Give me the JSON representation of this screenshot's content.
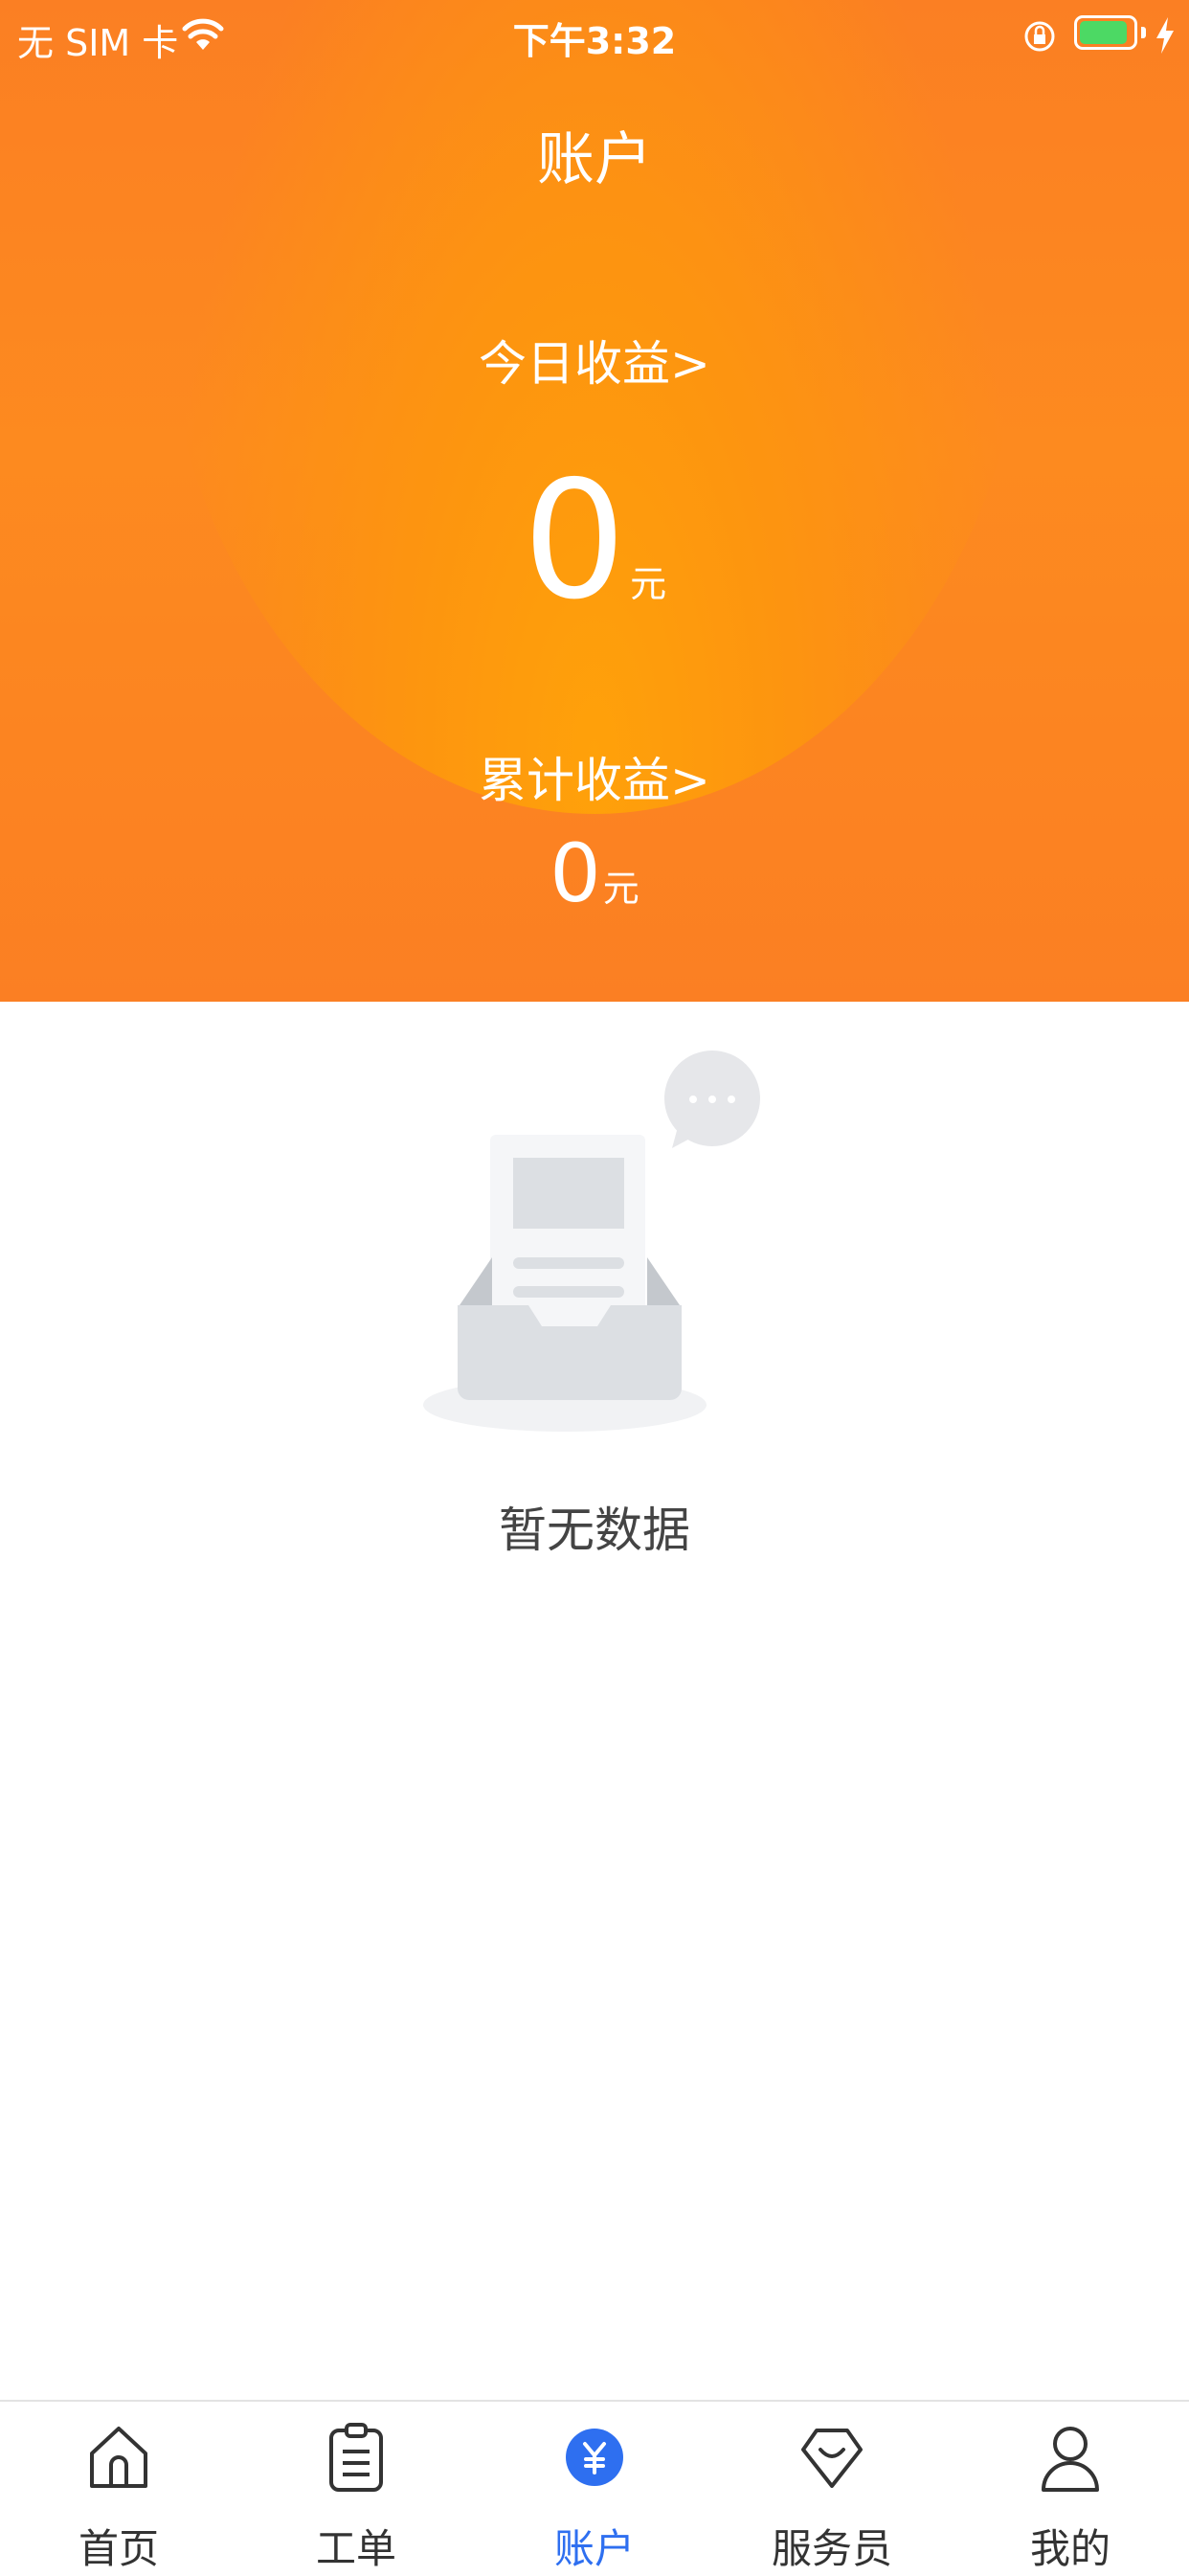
{
  "status_bar": {
    "carrier": "无 SIM 卡",
    "time": "下午3:32",
    "battery_color": "#4cd964",
    "battery_fill_fraction": 0.9
  },
  "header": {
    "title": "账户",
    "today_label": "今日收益>",
    "today_value": "0",
    "today_unit": "元",
    "total_label": "累计收益>",
    "total_value": "0",
    "total_unit": "元",
    "accent_color": "#fb7f23"
  },
  "empty_state": {
    "text": "暂无数据",
    "icon": "empty-inbox-icon"
  },
  "tab_bar": {
    "active_color": "#2e6ff0",
    "items": [
      {
        "label": "首页",
        "icon": "home-icon"
      },
      {
        "label": "工单",
        "icon": "clipboard-icon"
      },
      {
        "label": "账户",
        "icon": "yen-coin-icon",
        "active": true
      },
      {
        "label": "服务员",
        "icon": "diamond-badge-icon"
      },
      {
        "label": "我的",
        "icon": "user-icon"
      }
    ]
  }
}
